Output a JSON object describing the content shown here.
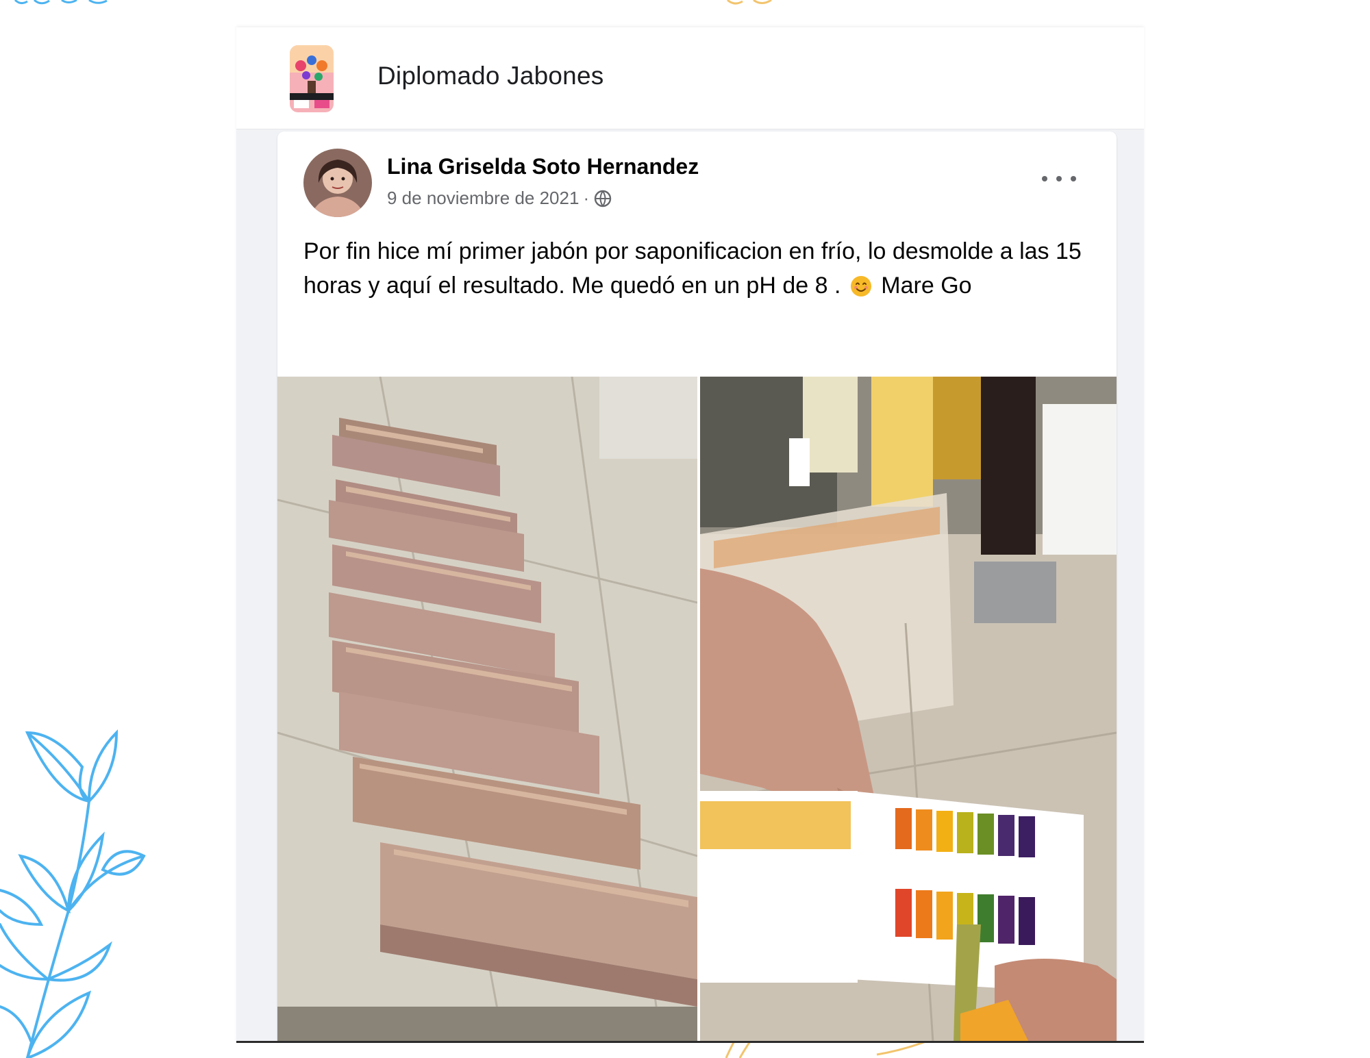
{
  "group": {
    "name": "Diplomado Jabones"
  },
  "post": {
    "author": "Lina Griselda Soto Hernandez",
    "date": "9 de noviembre de 2021",
    "separator": "·",
    "privacy_icon": "globe-icon",
    "text_before_emoji": "Por fin hice mí primer jabón por saponificacion en frío, lo desmolde a las 15 horas y aquí el resultado. Me quedó en un pH de 8 . ",
    "emoji": "smiling-face-emoji",
    "text_after_emoji": " Mare Go",
    "more_icon": "more-options-icon"
  },
  "photos": [
    {
      "subject": "soap-bars-photo"
    },
    {
      "subject": "ph-test-strip-photo"
    }
  ],
  "colors": {
    "decor_blue": "#4db3f0",
    "decor_gold": "#f2c46d",
    "text_primary": "#050505",
    "text_secondary": "#65676b"
  }
}
